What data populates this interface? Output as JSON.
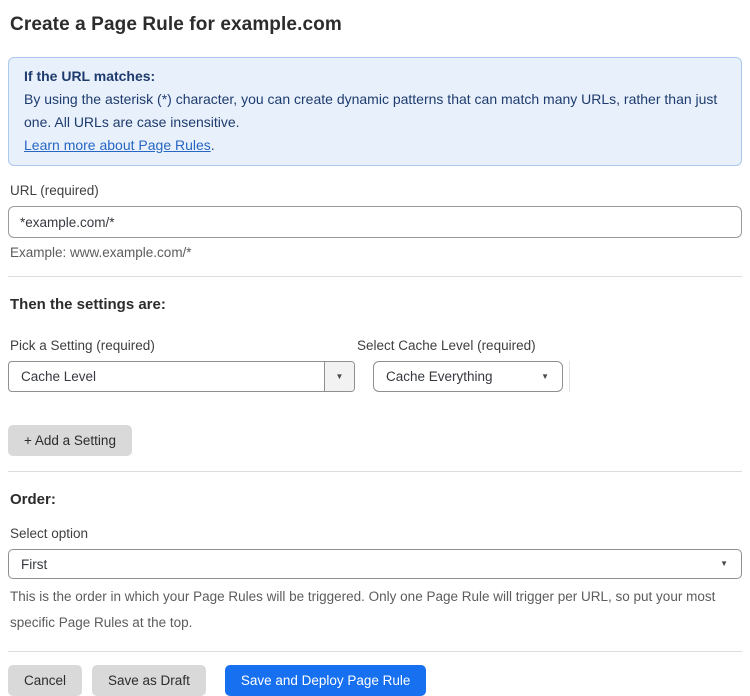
{
  "page": {
    "title": "Create a Page Rule for example.com"
  },
  "info_box": {
    "heading": "If the URL matches:",
    "body": "By using the asterisk (*) character, you can create dynamic patterns that can match many URLs, rather than just one. All URLs are case insensitive.",
    "link_label": "Learn more about Page Rules",
    "link_suffix": "."
  },
  "url_field": {
    "label": "URL (required)",
    "value": "*example.com/*",
    "helper": "Example: www.example.com/*"
  },
  "settings_section": {
    "heading": "Then the settings are:",
    "setting_picker": {
      "label": "Pick a Setting (required)",
      "selected": "Cache Level"
    },
    "cache_level_picker": {
      "label": "Select Cache Level (required)",
      "selected": "Cache Everything"
    },
    "add_setting_label": "+ Add a Setting"
  },
  "order_section": {
    "heading": "Order:",
    "select_label": "Select option",
    "selected": "First",
    "helper": "This is the order in which your Page Rules will be triggered. Only one Page Rule will trigger per URL, so put your most specific Page Rules at the top."
  },
  "actions": {
    "cancel": "Cancel",
    "save_draft": "Save as Draft",
    "save_deploy": "Save and Deploy Page Rule"
  },
  "icons": {
    "dropdown_arrow": "▼"
  },
  "colors": {
    "accent_blue": "#1670f0",
    "info_background": "#e8f1fb",
    "info_border": "#abc9ec",
    "info_text": "#1e3b6e",
    "link_blue": "#2766c2",
    "button_gray": "#d9d9d9"
  }
}
